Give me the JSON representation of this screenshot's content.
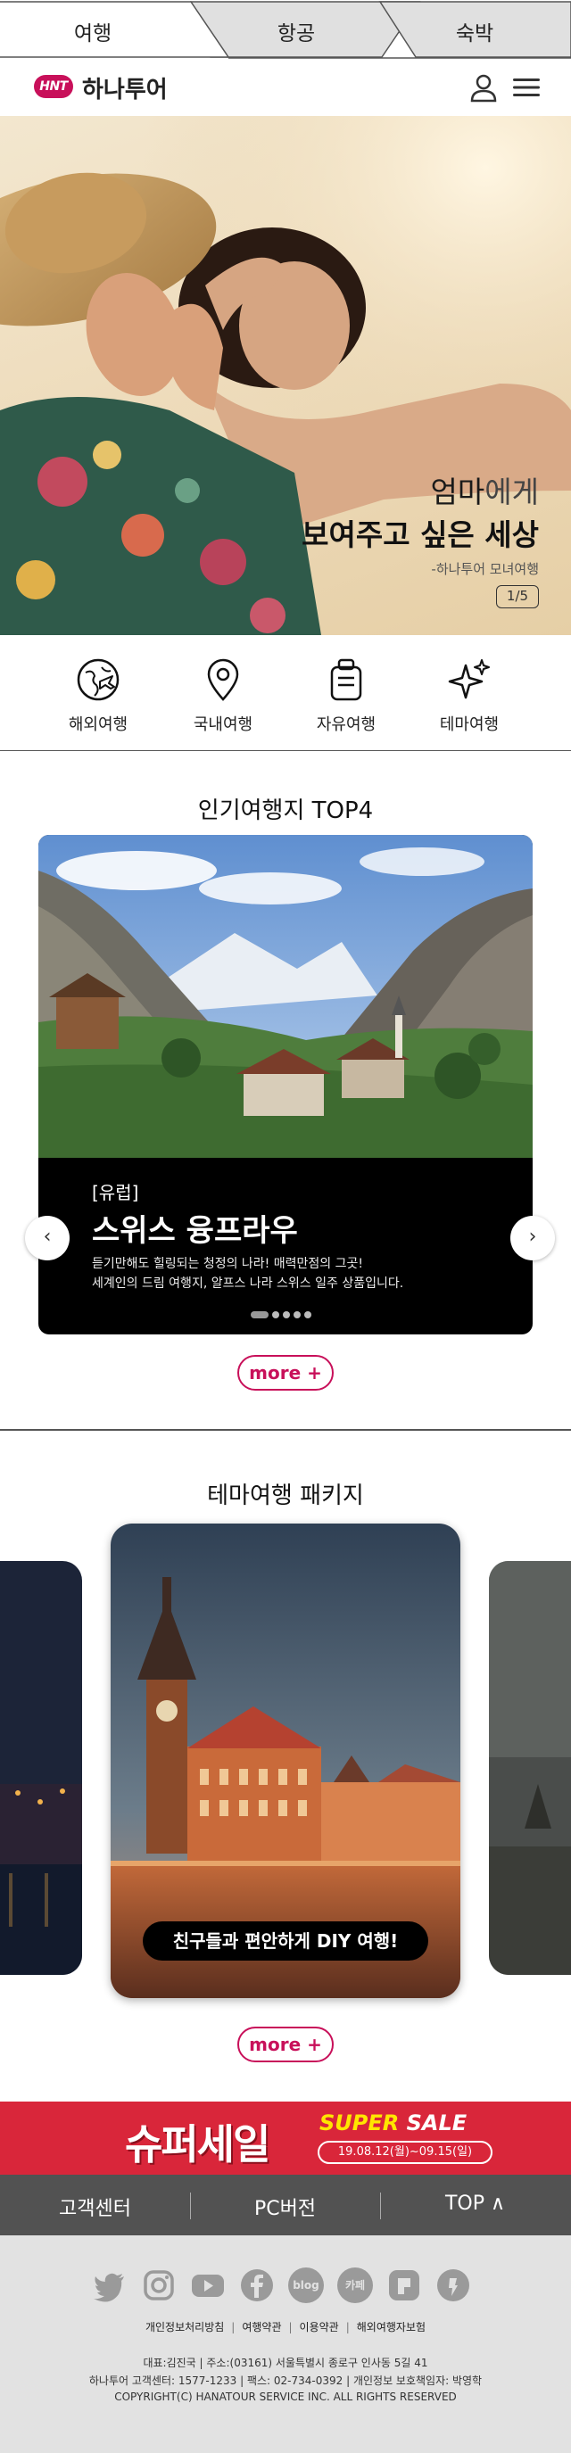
{
  "tabs": [
    {
      "label": "여행",
      "active": true
    },
    {
      "label": "항공",
      "active": false
    },
    {
      "label": "숙박",
      "active": false
    }
  ],
  "header": {
    "logo_badge": "HNT",
    "logo_text": "하나투어",
    "brand_color": "#c8105a"
  },
  "hero": {
    "title_line1_strong": "엄마",
    "title_line1_rest": "에게",
    "title_line2": "보여주고 싶은 세상",
    "subtitle": "-하나투어 모녀여행",
    "counter": "1/5"
  },
  "quick_menu": [
    {
      "label": "해외여행",
      "icon": "globe-plane-icon"
    },
    {
      "label": "국내여행",
      "icon": "map-pin-icon"
    },
    {
      "label": "자유여행",
      "icon": "luggage-icon"
    },
    {
      "label": "테마여행",
      "icon": "sparkle-icon"
    }
  ],
  "popular": {
    "title": "인기여행지 TOP4",
    "tag": "[유럽]",
    "name": "스위스 융프라우",
    "desc_line1": "듣기만해도 힐링되는 청정의 나라! 매력만점의 그곳!",
    "desc_line2": "세계인의 드림 여행지, 알프스 나라 스위스 일주 상품입니다.",
    "slide_count": 5,
    "active_slide": 1,
    "more": "more +"
  },
  "theme": {
    "title": "테마여행 패키지",
    "pill": "친구들과 편안하게 DIY 여행!",
    "more": "more +"
  },
  "sale": {
    "main": "슈퍼세일",
    "en_super": "SUPER",
    "en_sale": "SALE",
    "date": "19.08.12(월)~09.15(일)",
    "color": "#d9263a"
  },
  "bottom_bar": {
    "links": [
      "고객센터",
      "PC버전",
      "TOP ∧"
    ]
  },
  "footer": {
    "social": [
      "twitter-icon",
      "instagram-icon",
      "youtube-icon",
      "facebook-icon",
      "blog-icon",
      "kakao-icon",
      "post-icon",
      "kakaostory-icon"
    ],
    "social_text": {
      "blog": "blog",
      "kakao": "카페"
    },
    "links": [
      "개인정보처리방침",
      "여행약관",
      "이용약관",
      "해외여행자보험"
    ],
    "info_line1": "대표:김진국 | 주소:(03161) 서울특별시 종로구 인사동 5길 41",
    "info_line2": "하나투어 고객센터: 1577-1233 | 팩스: 02-734-0392 | 개인정보 보호책임자: 박영학",
    "info_line3": "COPYRIGHT(C) HANATOUR SERVICE INC. ALL RIGHTS RESERVED"
  }
}
